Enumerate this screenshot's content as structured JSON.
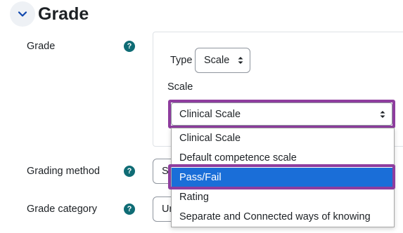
{
  "section": {
    "title": "Grade"
  },
  "grade_row": {
    "label": "Grade",
    "help": "?"
  },
  "type_field": {
    "label": "Type",
    "value": "Scale"
  },
  "scale_field": {
    "label": "Scale",
    "value": "Clinical Scale"
  },
  "grading_method": {
    "label": "Grading method",
    "help": "?",
    "value_partial": "Si"
  },
  "grade_category": {
    "label": "Grade category",
    "help": "?",
    "value_partial": "Ur"
  },
  "dropdown": {
    "options": [
      "Clinical Scale",
      "Default competence scale",
      "Pass/Fail",
      "Rating",
      "Separate and Connected ways of knowing"
    ],
    "highlighted_index": 2
  },
  "colors": {
    "highlight_border": "#8e3d9e",
    "selected_option": "#1a6ed8",
    "help_icon": "#0f6c75"
  }
}
